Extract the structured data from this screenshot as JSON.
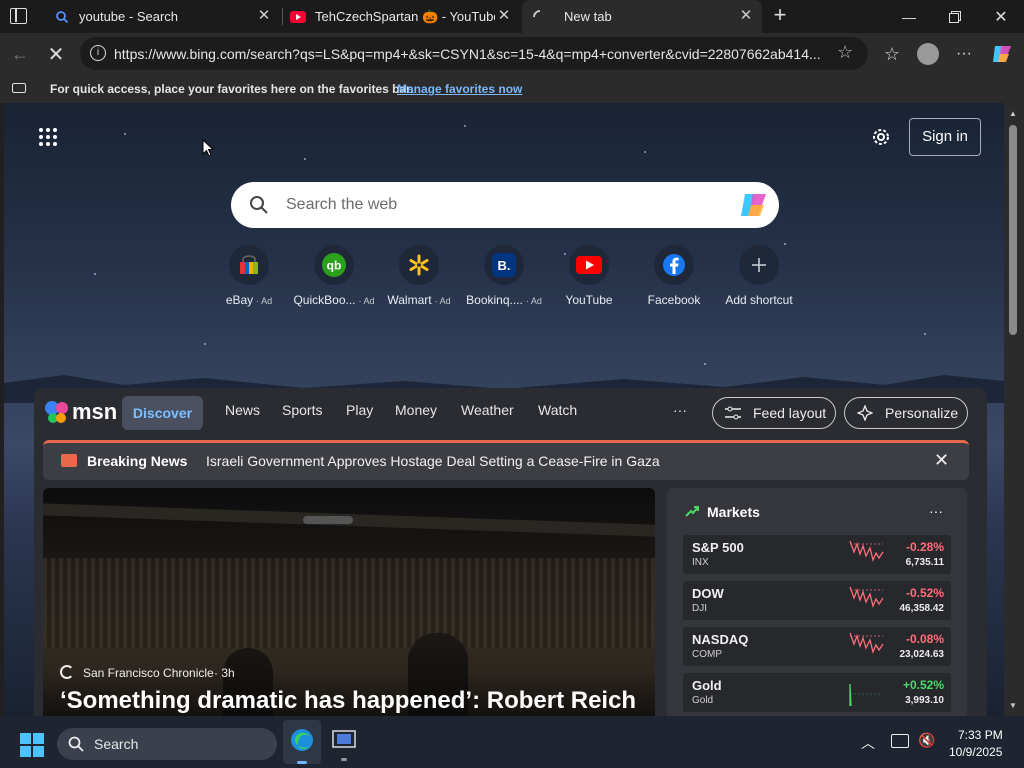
{
  "tabs": [
    {
      "title": "youtube - Search",
      "icon": "bing-search-icon"
    },
    {
      "title": "TehCzechSpartan 🎃 - YouTube",
      "icon": "youtube-icon"
    },
    {
      "title": "New tab",
      "icon": "loading-icon"
    }
  ],
  "address_bar": {
    "url": "https://www.bing.com/search?qs=LS&pq=mp4+&sk=CSYN1&sc=15-4&q=mp4+converter&cvid=22807662ab414..."
  },
  "favorites_bar": {
    "message": "For quick access, place your favorites here on the favorites bar.",
    "link": "Manage favorites now"
  },
  "newtab": {
    "sign_in": "Sign in",
    "search_placeholder": "Search the web",
    "shortcuts": [
      {
        "label": "eBay",
        "ad": "· Ad",
        "icon": "ebay-icon",
        "color": "#ffffff"
      },
      {
        "label": "QuickBoo...",
        "ad": "· Ad",
        "icon": "quickbooks-icon",
        "color": "#2ca01c"
      },
      {
        "label": "Walmart",
        "ad": "· Ad",
        "icon": "walmart-icon",
        "color": "#0071ce"
      },
      {
        "label": "Bookinq....",
        "ad": "· Ad",
        "icon": "booking-icon",
        "color": "#003580"
      },
      {
        "label": "YouTube",
        "ad": "",
        "icon": "youtube-icon",
        "color": "#ff0000"
      },
      {
        "label": "Facebook",
        "ad": "",
        "icon": "facebook-icon",
        "color": "#1877f2"
      },
      {
        "label": "Add shortcut",
        "ad": "",
        "icon": "plus-icon",
        "color": "#9aa0aa"
      }
    ]
  },
  "feed": {
    "brand": "msn",
    "nav": [
      "Discover",
      "News",
      "Sports",
      "Play",
      "Money",
      "Weather",
      "Watch"
    ],
    "more": "···",
    "feed_layout": "Feed layout",
    "personalize": "Personalize",
    "breaking_label": "Breaking News",
    "breaking_headline": "Israeli Government Approves Hostage Deal Setting a Cease-Fire in Gaza",
    "hero": {
      "source": "San Francisco Chronicle",
      "age": "· 3h",
      "headline": "‘Something dramatic has happened’: Robert Reich"
    },
    "markets": {
      "title": "Markets",
      "more": "···",
      "rows": [
        {
          "name": "S&P 500",
          "symbol": "INX",
          "change": "-0.28%",
          "value": "6,735.11",
          "dir": "down"
        },
        {
          "name": "DOW",
          "symbol": "DJI",
          "change": "-0.52%",
          "value": "46,358.42",
          "dir": "down"
        },
        {
          "name": "NASDAQ",
          "symbol": "COMP",
          "change": "-0.08%",
          "value": "23,024.63",
          "dir": "down"
        },
        {
          "name": "Gold",
          "symbol": "Gold",
          "change": "+0.52%",
          "value": "3,993.10",
          "dir": "up"
        }
      ],
      "colors": {
        "down": "#ff6e7a",
        "up": "#4cd964"
      }
    }
  },
  "taskbar": {
    "search": "Search",
    "time": "7:33 PM",
    "date": "10/9/2025"
  }
}
